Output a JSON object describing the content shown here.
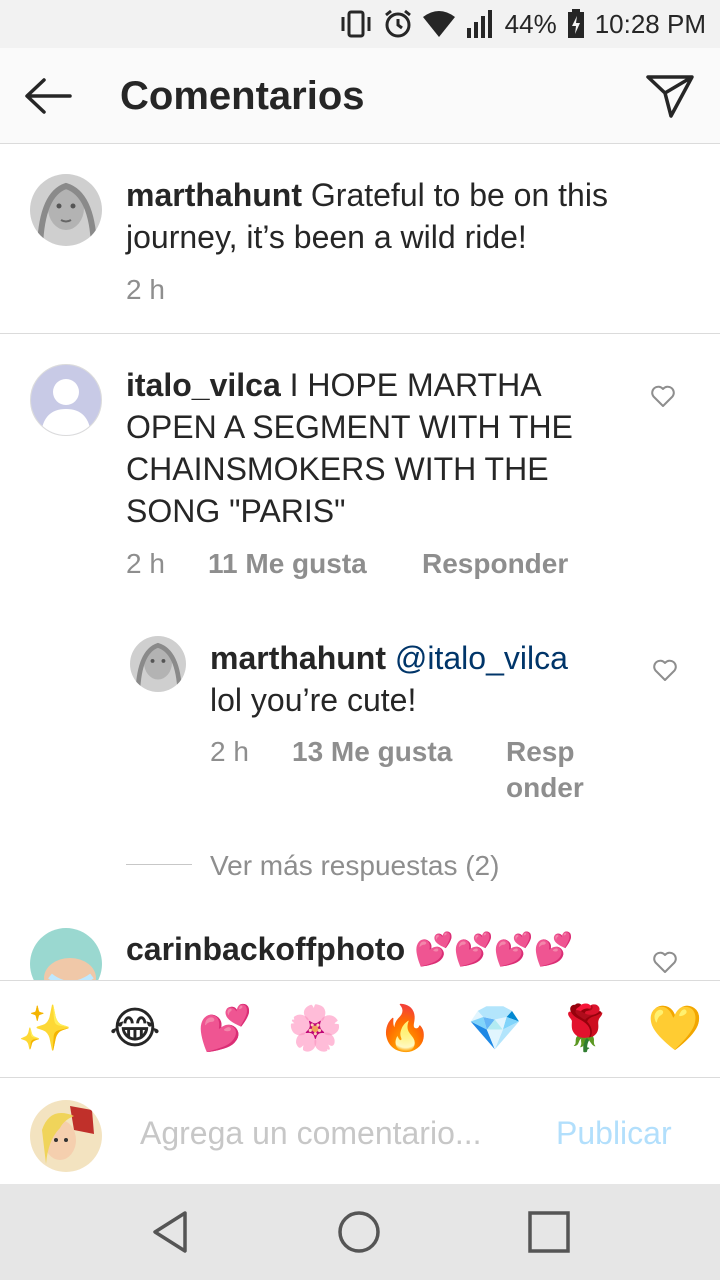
{
  "status_bar": {
    "battery": "44%",
    "time": "10:28 PM",
    "icons": [
      "vibrate-icon",
      "alarm-icon",
      "wifi-icon",
      "signal-icon",
      "battery-icon"
    ]
  },
  "header": {
    "title": "Comentarios",
    "back_icon": "arrow-left-icon",
    "send_icon": "paper-plane-icon"
  },
  "caption": {
    "username": "marthahunt",
    "text": "Grateful to be on this journey, it’s been a wild ride!",
    "time": "2 h"
  },
  "comments": [
    {
      "username": "italo_vilca",
      "text": "I HOPE MARTHA OPEN A SEGMENT WITH THE CHAINSMOKERS WITH THE SONG \"PARIS\"",
      "time": "2 h",
      "likes": "11 Me gusta",
      "reply": "Responder"
    },
    {
      "username": "marthahunt",
      "mention": "@italo_vilca",
      "text": "lol you’re cute!",
      "time": "2 h",
      "likes": "13 Me gusta",
      "reply_line1": "Resp",
      "reply_line2": "onder"
    }
  ],
  "view_more_replies": "Ver más respuestas (2)",
  "partial_comment": {
    "username": "carinbackoffphoto",
    "text": "💕💕💕💕"
  },
  "emoji_bar": [
    "✨",
    "😂",
    "💕",
    "🌸",
    "🔥",
    "💎",
    "🌹",
    "💛"
  ],
  "comment_input": {
    "placeholder": "Agrega un comentario...",
    "publish_label": "Publicar"
  },
  "nav_bar": [
    "back-triangle-icon",
    "home-circle-icon",
    "recents-square-icon"
  ],
  "colors": {
    "text": "#262626",
    "meta": "#8e8e8e",
    "mention": "#003569",
    "publish_disabled": "#b2dffc",
    "divider": "#dbdbdb"
  }
}
